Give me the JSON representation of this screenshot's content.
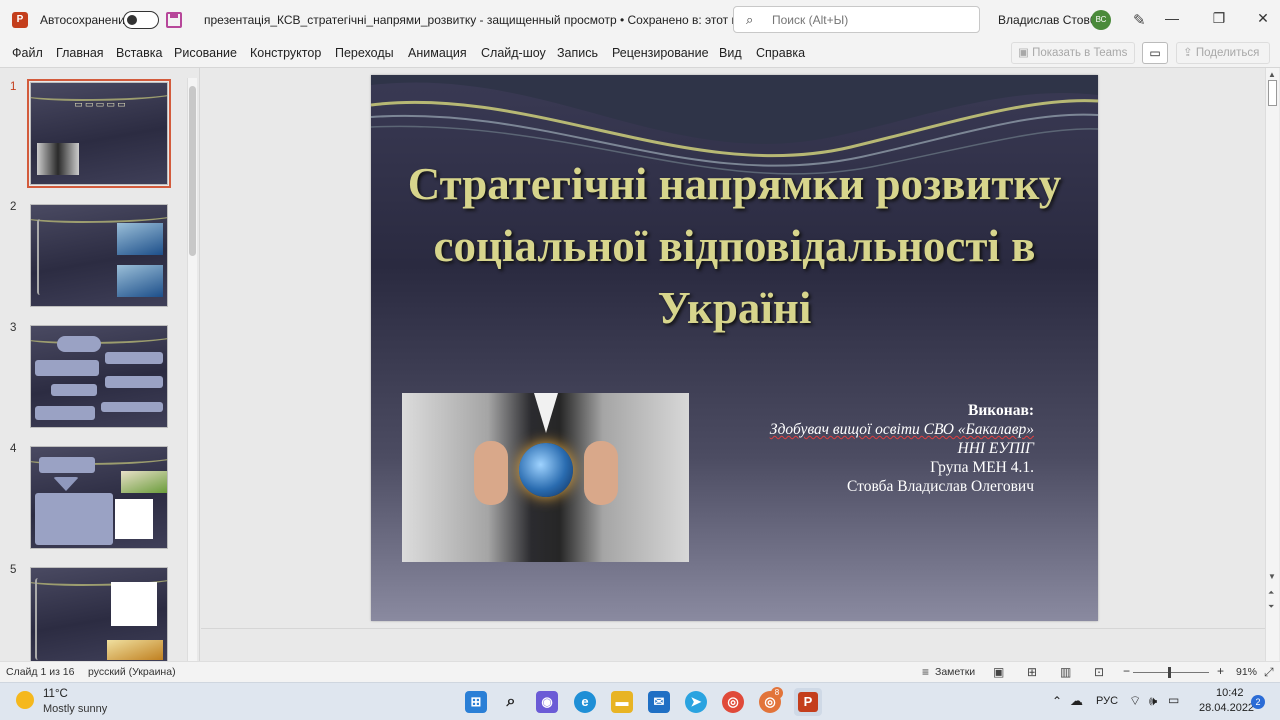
{
  "titlebar": {
    "autosave_label": "Автосохранение",
    "autosave_on": false,
    "doc_title": "презентація_КСВ_стратегічні_напрями_розвитку  -  защищенный просмотр • Сохранено в: этот компьютер",
    "search_placeholder": "Поиск (Alt+Ы)",
    "user_name": "Владислав Стовба",
    "user_initials": "ВС"
  },
  "menu": {
    "items": [
      "Файл",
      "Главная",
      "Вставка",
      "Рисование",
      "Конструктор",
      "Переходы",
      "Анимация",
      "Слайд-шоу",
      "Запись",
      "Рецензирование",
      "Вид",
      "Справка"
    ],
    "teams_label": "Показать в Teams",
    "share_label": "Поделиться"
  },
  "thumbnails": [
    {
      "num": "1",
      "active": true
    },
    {
      "num": "2",
      "active": false
    },
    {
      "num": "3",
      "active": false
    },
    {
      "num": "4",
      "active": false
    },
    {
      "num": "5",
      "active": false
    }
  ],
  "slide": {
    "title": "Стратегічні напрямки розвитку соціальної відповідальності в Україні",
    "info_label": "Виконав:",
    "info_role": "Здобувач вищої освіти СВО «Бакалавр»",
    "info_institute": "ННІ ЕУПІГ",
    "info_group": "Група МЕН 4.1.",
    "info_name": "Стовба Владислав Олегович"
  },
  "statusbar": {
    "slide_counter": "Слайд 1 из 16",
    "language": "русский (Украина)",
    "notes_label": "Заметки",
    "zoom": "91%"
  },
  "taskbar": {
    "temperature": "11°C",
    "weather": "Mostly sunny",
    "lang": "РУС",
    "time": "10:42",
    "date": "28.04.2022",
    "notifications": "2",
    "badge_app": "8"
  },
  "colors": {
    "accent": "#c43e1c",
    "slide_title": "#d7d58c",
    "slide_bg": "#2a2a40"
  }
}
